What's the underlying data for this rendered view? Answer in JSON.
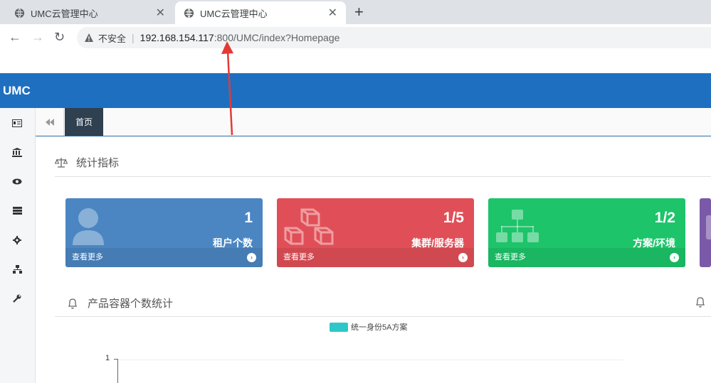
{
  "browser": {
    "tabs": [
      {
        "title": "UMC云管理中心",
        "active": false
      },
      {
        "title": "UMC云管理中心",
        "active": true
      }
    ],
    "security_label": "不安全",
    "url_host": "192.168.154.117",
    "url_rest": ":800/UMC/index?Homepage"
  },
  "app": {
    "brand": "UMC",
    "sidebar_icons": [
      "id-card-icon",
      "bank-icon",
      "eye-icon",
      "server-icon",
      "gear-icon",
      "sitemap-icon",
      "wrench-icon"
    ],
    "home_tab": "首页",
    "stats_section": {
      "title": "统计指标"
    },
    "cards": [
      {
        "value": "1",
        "label": "租户个数",
        "more": "查看更多",
        "color": "#4b86c2",
        "icon": "user-icon"
      },
      {
        "value": "1/5",
        "label": "集群/服务器",
        "more": "查看更多",
        "color": "#e04f57",
        "icon": "cubes-icon"
      },
      {
        "value": "1/2",
        "label": "方案/环境",
        "more": "查看更多",
        "color": "#1dc46a",
        "icon": "sitemap-icon"
      }
    ],
    "chart_section": {
      "title": "产品容器个数统计"
    }
  },
  "chart_data": {
    "type": "bar",
    "series": [
      {
        "name": "统一身份5A方案",
        "values": []
      }
    ],
    "y_ticks": [
      "1"
    ],
    "ylim": [
      0,
      1
    ],
    "legend_position": "top-center",
    "colors": [
      "#2ec7c9"
    ]
  }
}
